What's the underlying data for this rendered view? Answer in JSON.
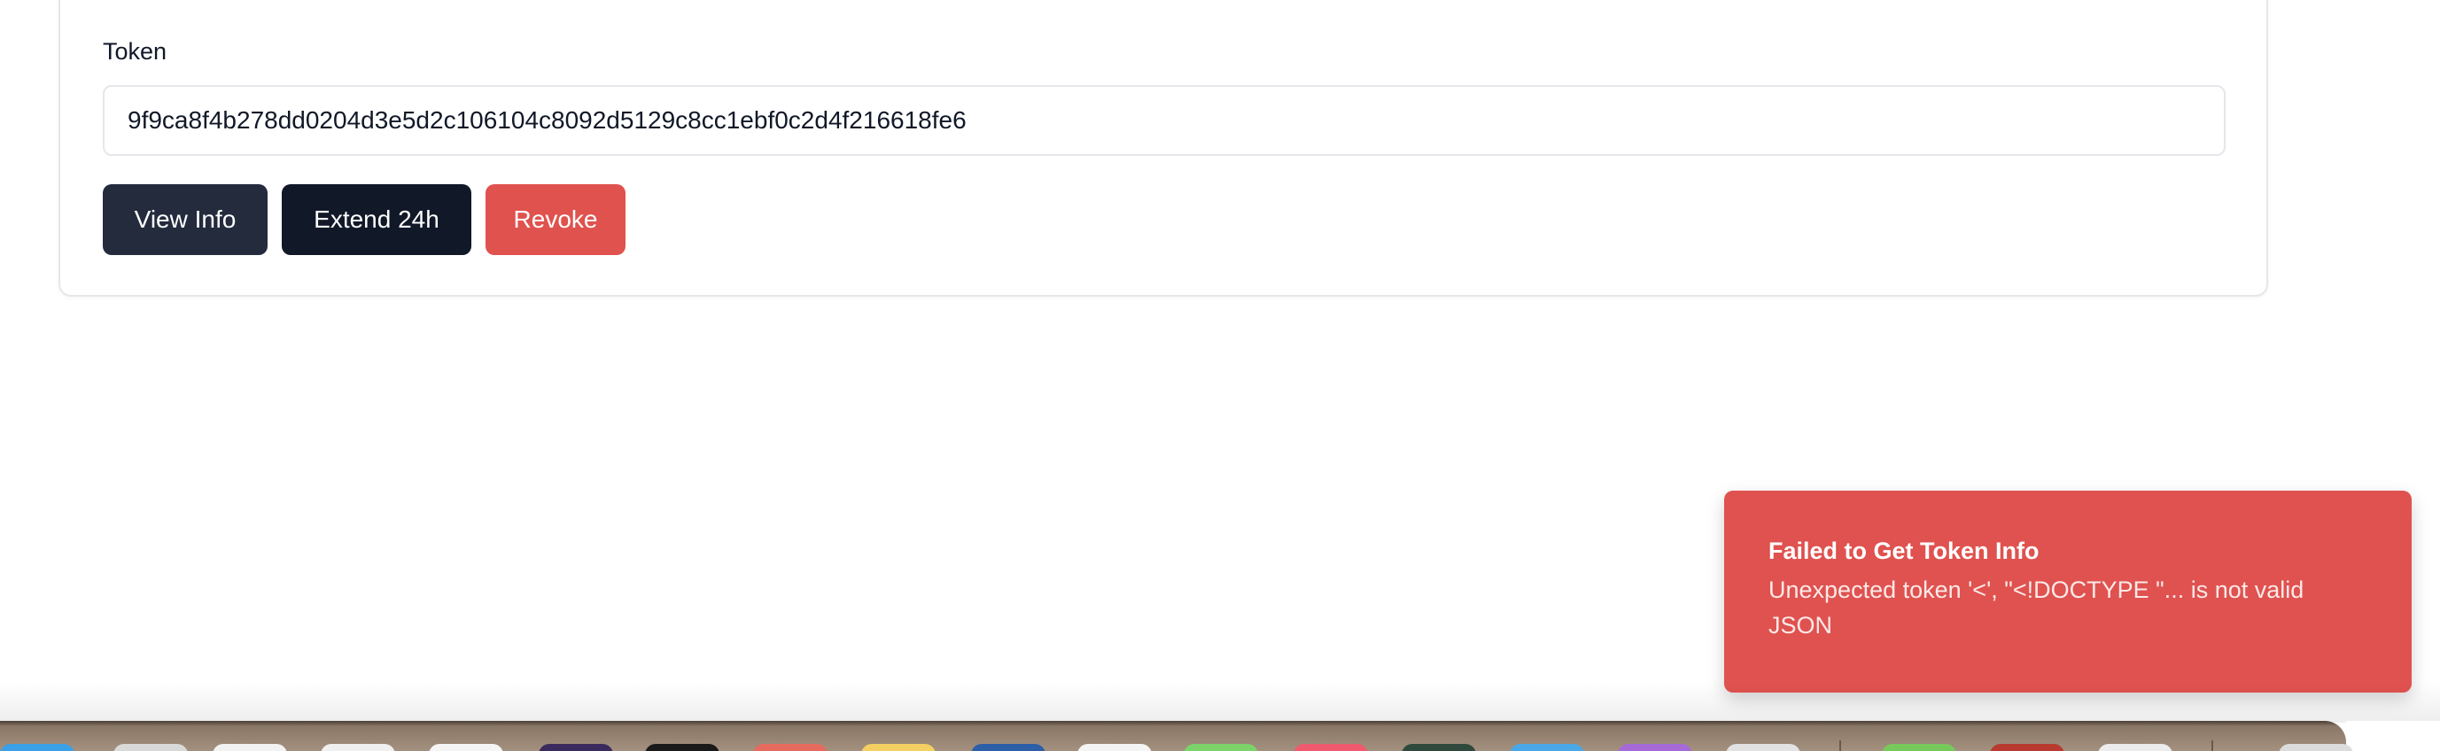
{
  "token_form": {
    "label": "Token",
    "value": "9f9ca8f4b278dd0204d3e5d2c106104c8092d5129c8cc1ebf0c2d4f216618fe6"
  },
  "actions": {
    "view_info": "View Info",
    "extend": "Extend 24h",
    "revoke": "Revoke"
  },
  "toast": {
    "title": "Failed to Get Token Info",
    "description": "Unexpected token '<', \"<!DOCTYPE \"... is not valid JSON"
  },
  "colors": {
    "view_info_button": "#232b3d",
    "extend_button": "#111828",
    "revoke_button": "#e0524e",
    "toast_background": "#df524f"
  },
  "dock": {
    "icons": [
      {
        "name": "finder-icon",
        "color": "#3aa0e8"
      },
      {
        "name": "launchpad-icon",
        "color": "#d9d9d9"
      },
      {
        "name": "safari-icon",
        "color": "#f2f2f2"
      },
      {
        "name": "mail-icon",
        "color": "#f0f0f0"
      },
      {
        "name": "calendar-icon",
        "color": "#f5f5f5"
      },
      {
        "name": "app-dark-purple-icon",
        "color": "#3b2a5e"
      },
      {
        "name": "terminal-icon",
        "color": "#1a1a1a"
      },
      {
        "name": "app-red-icon",
        "color": "#e76a5e"
      },
      {
        "name": "notes-icon",
        "color": "#f3d061"
      },
      {
        "name": "app-blue-icon",
        "color": "#2d5fa8"
      },
      {
        "name": "app-white-icon",
        "color": "#f4f4f4"
      },
      {
        "name": "messages-icon",
        "color": "#7bd36a"
      },
      {
        "name": "music-icon",
        "color": "#ef5a6e"
      },
      {
        "name": "app-dark-green-icon",
        "color": "#2f4a3c"
      },
      {
        "name": "app-sky-icon",
        "color": "#4aa8e8"
      },
      {
        "name": "app-violet-icon",
        "color": "#a56ad8"
      },
      {
        "name": "app-light-gray-icon",
        "color": "#e2e2e2"
      },
      {
        "name": "app-green-icon",
        "color": "#77c95b"
      },
      {
        "name": "app-dark-red-icon",
        "color": "#b83a30"
      },
      {
        "name": "app-pale-icon",
        "color": "#ececec"
      },
      {
        "name": "trash-icon",
        "color": "#dcdcdc"
      }
    ]
  }
}
